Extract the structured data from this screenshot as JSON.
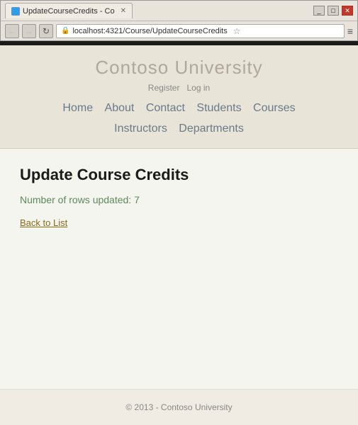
{
  "browser": {
    "tab_label": "UpdateCourseCredits - Co",
    "url": "localhost:4321/Course/UpdateCourseCredits",
    "tab_icon": "🌐"
  },
  "site": {
    "title": "Contoso University",
    "auth": {
      "register": "Register",
      "login": "Log in"
    },
    "nav": {
      "home": "Home",
      "about": "About",
      "contact": "Contact",
      "students": "Students",
      "courses": "Courses",
      "instructors": "Instructors",
      "departments": "Departments"
    }
  },
  "page": {
    "heading": "Update Course Credits",
    "status": "Number of rows updated: 7",
    "back_link": "Back to List"
  },
  "footer": {
    "text": "© 2013 - Contoso University"
  },
  "icons": {
    "back": "←",
    "forward": "→",
    "refresh": "↻",
    "lock": "🔒",
    "star": "☆",
    "menu": "≡",
    "minimize": "_",
    "maximize": "□",
    "close": "✕"
  }
}
